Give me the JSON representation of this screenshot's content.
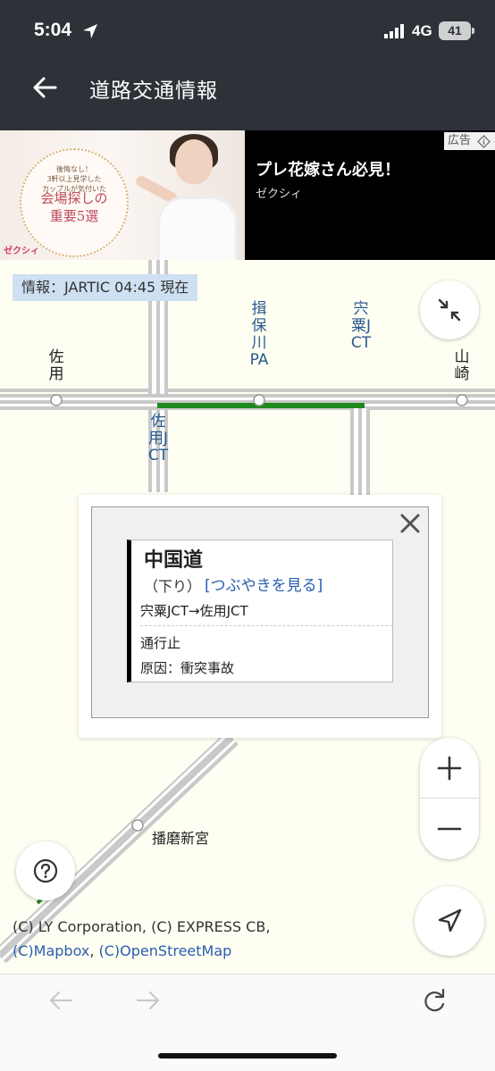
{
  "status": {
    "time": "5:04",
    "network": "4G",
    "battery": "41"
  },
  "header": {
    "title": "道路交通情報"
  },
  "ad": {
    "ring_small_text": "後悔なし！\n3軒以上見学した\nカップルが気付いた",
    "ring_big_text": "会場探しの\n重要5選",
    "logo": "ゼクシィ",
    "headline": "プレ花嫁さん必見！",
    "sponsor": "ゼクシィ",
    "badge": "広告"
  },
  "map": {
    "info_chip": "情報：JARTIC 04:45 現在",
    "labels": {
      "saku": "佐用",
      "ibo_pa": "揖保川PA",
      "shiso_jct": "宍粟JCT",
      "yamasaki": "山崎",
      "saku_jct": "佐用JCT",
      "harima_shingu": "播磨新宮"
    }
  },
  "popup": {
    "road": "中国道",
    "direction": "（下り）",
    "tweet_link": "[つぶやきを見る]",
    "section": "宍粟JCT→佐用JCT",
    "status": "通行止",
    "cause": "原因：衝突事故"
  },
  "copyright": {
    "line1": "(C) LY Corporation, (C) EXPRESS CB,",
    "mapbox": "(C)Mapbox",
    "sep": ", ",
    "osm": "(C)OpenStreetMap"
  },
  "colors": {
    "closed_road": "#1e8a1e",
    "link": "#2a5db0",
    "header_bg": "#2e3238"
  }
}
